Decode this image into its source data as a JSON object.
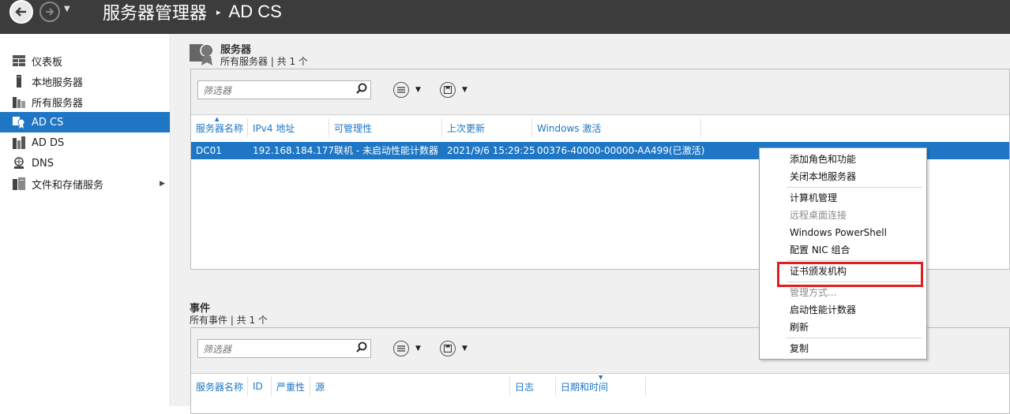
{
  "titlebar": {
    "breadcrumb_root": "服务器管理器",
    "breadcrumb_sep": "▸",
    "breadcrumb_current": "AD CS"
  },
  "sidebar": {
    "items": [
      {
        "label": "仪表板",
        "icon": "dashboard-icon"
      },
      {
        "label": "本地服务器",
        "icon": "server-icon"
      },
      {
        "label": "所有服务器",
        "icon": "servers-icon"
      },
      {
        "label": "AD CS",
        "icon": "certificate-services-icon",
        "active": true
      },
      {
        "label": "AD DS",
        "icon": "directory-services-icon"
      },
      {
        "label": "DNS",
        "icon": "dns-icon"
      },
      {
        "label": "文件和存储服务",
        "icon": "file-storage-icon",
        "has_children": true
      }
    ]
  },
  "servers": {
    "title": "服务器",
    "subtitle": "所有服务器 | 共 1 个",
    "filter_placeholder": "筛选器",
    "columns": [
      "服务器名称",
      "IPv4 地址",
      "可管理性",
      "上次更新",
      "Windows 激活"
    ],
    "rows": [
      {
        "name": "DC01",
        "ip": "192.168.184.177",
        "manageability": "联机 - 未启动性能计数器",
        "last_update": "2021/9/6 15:29:25",
        "activation": "00376-40000-00000-AA499(已激活)"
      }
    ]
  },
  "events": {
    "title": "事件",
    "subtitle": "所有事件 | 共 1 个",
    "filter_placeholder": "筛选器",
    "columns": [
      "服务器名称",
      "ID",
      "严重性",
      "源",
      "日志",
      "日期和时间"
    ]
  },
  "context_menu": {
    "items": [
      {
        "label": "添加角色和功能",
        "enabled": true
      },
      {
        "label": "关闭本地服务器",
        "enabled": true
      },
      {
        "label": "计算机管理",
        "enabled": true
      },
      {
        "label": "远程桌面连接",
        "enabled": false
      },
      {
        "label": "Windows PowerShell",
        "enabled": true
      },
      {
        "label": "配置 NIC 组合",
        "enabled": true
      },
      {
        "label": "证书颁发机构",
        "enabled": true,
        "highlighted": true
      },
      {
        "label": "管理方式...",
        "enabled": false
      },
      {
        "label": "启动性能计数器",
        "enabled": true
      },
      {
        "label": "刷新",
        "enabled": true
      },
      {
        "label": "复制",
        "enabled": true
      }
    ]
  },
  "colors": {
    "accent": "#1e76c4",
    "titlebar": "#3c3c3c",
    "highlight_box": "#e02020"
  }
}
